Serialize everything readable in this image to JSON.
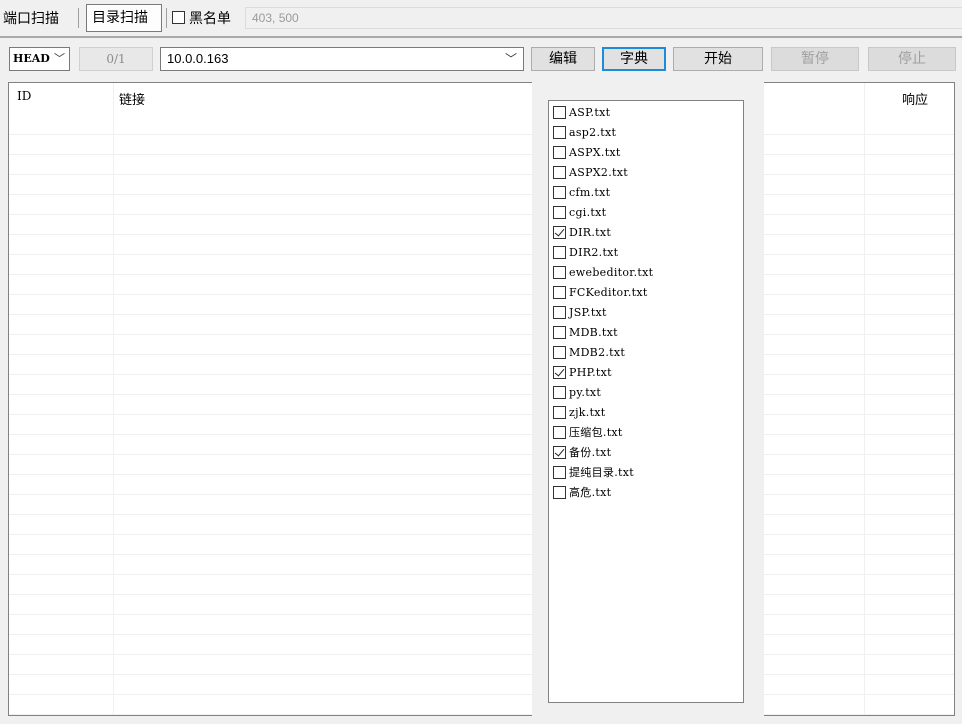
{
  "tabs": {
    "port_scan": "端口扫描",
    "dir_scan": "目录扫描"
  },
  "blacklist": {
    "label": "黑名单",
    "checked": false,
    "codes": "403, 500"
  },
  "toolbar": {
    "method": "HEAD",
    "progress": "0/1",
    "url": "10.0.0.163",
    "edit_label": "编辑",
    "dict_label": "字典",
    "start_label": "开始",
    "pause_label": "暂停",
    "stop_label": "停止"
  },
  "table": {
    "columns": [
      "ID",
      "链接",
      "响应"
    ]
  },
  "dictionary": {
    "items": [
      {
        "label": "ASP.txt",
        "checked": false
      },
      {
        "label": "asp2.txt",
        "checked": false
      },
      {
        "label": "ASPX.txt",
        "checked": false
      },
      {
        "label": "ASPX2.txt",
        "checked": false
      },
      {
        "label": "cfm.txt",
        "checked": false
      },
      {
        "label": "cgi.txt",
        "checked": false
      },
      {
        "label": "DIR.txt",
        "checked": true
      },
      {
        "label": "DIR2.txt",
        "checked": false
      },
      {
        "label": "ewebeditor.txt",
        "checked": false
      },
      {
        "label": "FCKeditor.txt",
        "checked": false
      },
      {
        "label": "JSP.txt",
        "checked": false
      },
      {
        "label": "MDB.txt",
        "checked": false
      },
      {
        "label": "MDB2.txt",
        "checked": false
      },
      {
        "label": "PHP.txt",
        "checked": true
      },
      {
        "label": "py.txt",
        "checked": false
      },
      {
        "label": "zjk.txt",
        "checked": false
      },
      {
        "label": "压缩包.txt",
        "checked": false
      },
      {
        "label": "备份.txt",
        "checked": true
      },
      {
        "label": "提纯目录.txt",
        "checked": false
      },
      {
        "label": "高危.txt",
        "checked": false
      }
    ]
  }
}
